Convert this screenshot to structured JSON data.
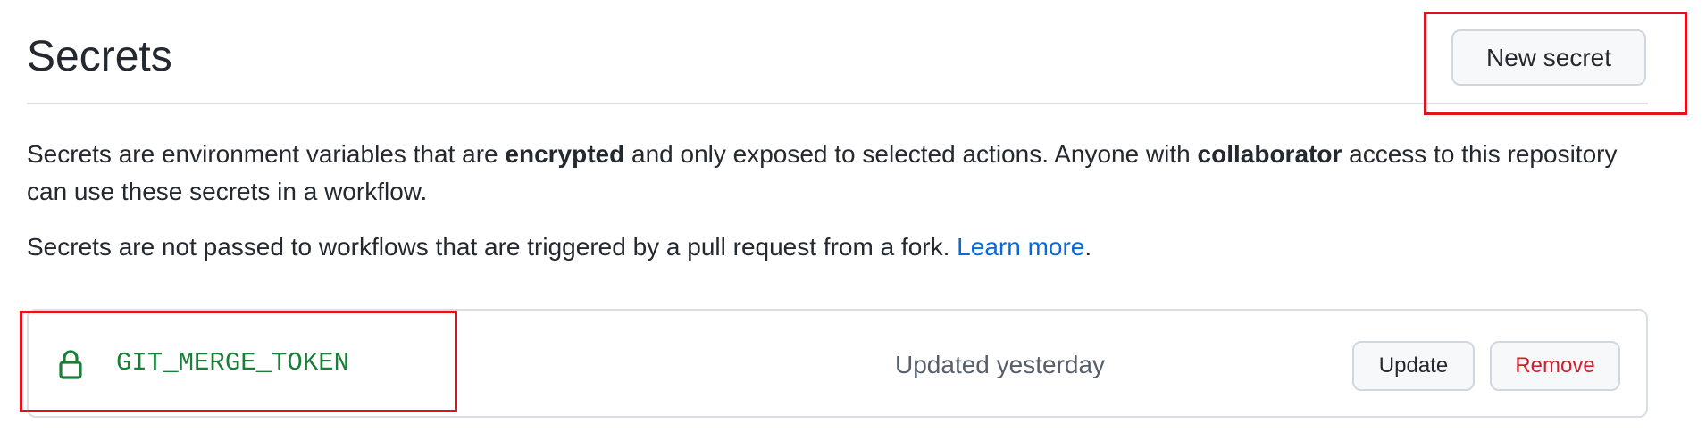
{
  "header": {
    "title": "Secrets",
    "new_secret_label": "New secret"
  },
  "description": {
    "p1_part1": "Secrets are environment variables that are ",
    "p1_bold1": "encrypted",
    "p1_part2": " and only exposed to selected actions. Anyone with ",
    "p1_bold2": "collaborator",
    "p1_part3": " access to this repository can use these secrets in a workflow.",
    "p2_text": "Secrets are not passed to workflows that are triggered by a pull request from a fork. ",
    "p2_link": "Learn more",
    "p2_end": "."
  },
  "secrets": [
    {
      "icon": "lock-icon",
      "name": "GIT_MERGE_TOKEN",
      "updated": "Updated yesterday",
      "update_label": "Update",
      "remove_label": "Remove"
    }
  ],
  "colors": {
    "secret_name": "#1a7f37",
    "link": "#0969da",
    "danger": "#cf222e",
    "highlight": "#e3111b"
  }
}
